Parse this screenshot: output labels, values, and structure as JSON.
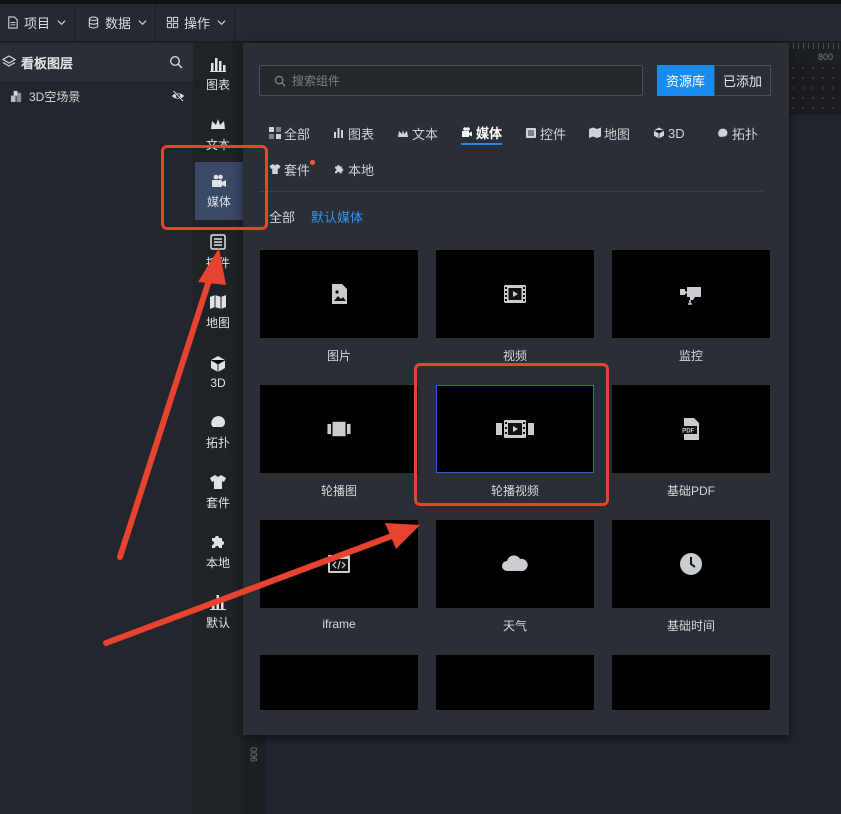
{
  "menubar": {
    "items": [
      {
        "label": "项目",
        "icon": "file-icon"
      },
      {
        "label": "数据",
        "icon": "database-icon"
      },
      {
        "label": "操作",
        "icon": "grid-icon"
      }
    ]
  },
  "layers": {
    "title": "看板图层",
    "rows": [
      {
        "label": "3D空场景",
        "icon": "cubes-icon",
        "visibility": "eye-off-icon"
      }
    ]
  },
  "sidebar": {
    "items": [
      {
        "label": "图表",
        "icon": "bar-chart-icon"
      },
      {
        "label": "文本",
        "icon": "crown-icon"
      },
      {
        "label": "媒体",
        "icon": "camera-icon",
        "active": true
      },
      {
        "label": "控件",
        "icon": "list-icon"
      },
      {
        "label": "地图",
        "icon": "map-icon"
      },
      {
        "label": "3D",
        "icon": "cube-icon"
      },
      {
        "label": "拓扑",
        "icon": "topology-icon"
      },
      {
        "label": "套件",
        "icon": "shirt-icon"
      },
      {
        "label": "本地",
        "icon": "puzzle-icon"
      },
      {
        "label": "默认",
        "icon": "bar-chart-icon"
      }
    ]
  },
  "ruler": {
    "top_label": "800",
    "left_label": "900"
  },
  "panel": {
    "search_placeholder": "搜索组件",
    "segments": [
      {
        "label": "资源库",
        "active": true
      },
      {
        "label": "已添加",
        "active": false
      }
    ],
    "tabs": [
      {
        "label": "全部",
        "icon": "grid-icon"
      },
      {
        "label": "图表",
        "icon": "bar-chart-icon"
      },
      {
        "label": "文本",
        "icon": "crown-icon"
      },
      {
        "label": "媒体",
        "icon": "camera-icon",
        "active": true
      },
      {
        "label": "控件",
        "icon": "list-icon"
      },
      {
        "label": "地图",
        "icon": "map-icon"
      },
      {
        "label": "3D",
        "icon": "cube-icon"
      },
      {
        "label": "拓扑",
        "icon": "topology-icon"
      },
      {
        "label": "套件",
        "icon": "shirt-icon",
        "badge": true
      },
      {
        "label": "本地",
        "icon": "puzzle-icon"
      }
    ],
    "subtabs": [
      {
        "label": "全部",
        "active": false
      },
      {
        "label": "默认媒体",
        "active": true
      }
    ],
    "cards": [
      {
        "label": "图片",
        "icon": "image-file-icon"
      },
      {
        "label": "视频",
        "icon": "film-icon"
      },
      {
        "label": "监控",
        "icon": "cctv-camera-icon"
      },
      {
        "label": "轮播图",
        "icon": "carousel-icon"
      },
      {
        "label": "轮播视频",
        "icon": "film-carousel-icon",
        "selected": true
      },
      {
        "label": "基础PDF",
        "icon": "pdf-icon"
      },
      {
        "label": "iframe",
        "icon": "code-window-icon"
      },
      {
        "label": "天气",
        "icon": "cloud-icon"
      },
      {
        "label": "基础时间",
        "icon": "clock-icon"
      },
      {
        "label": "",
        "icon": "calendar-icon"
      },
      {
        "label": "",
        "icon": "stopwatch-icon"
      },
      {
        "label": "",
        "icon": "timeline-icon"
      }
    ]
  },
  "colors": {
    "accent": "#1a8cf0",
    "annotation": "#e74330",
    "active_sidebar": "#3a4a66"
  }
}
